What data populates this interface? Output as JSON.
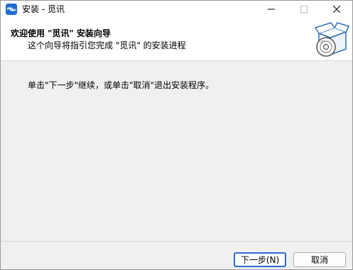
{
  "window": {
    "title": "安装 - 觅讯"
  },
  "header": {
    "title": "欢迎使用 \"觅讯\" 安装向导",
    "subtitle": "这个向导将指引您完成 \"觅讯\" 的安装进程",
    "graphic_icon": "package-disc-icon"
  },
  "body": {
    "instruction": "单击\"下一步\"继续，或单击\"取消\"退出安装程序。"
  },
  "buttons": {
    "next_label": "下一步(N)",
    "cancel_label": "取消"
  },
  "colors": {
    "app_icon": "#1f6fd1",
    "default_button_border": "#2a6ad3",
    "header_background": "#ffffff",
    "body_background": "#f0f0f0"
  }
}
